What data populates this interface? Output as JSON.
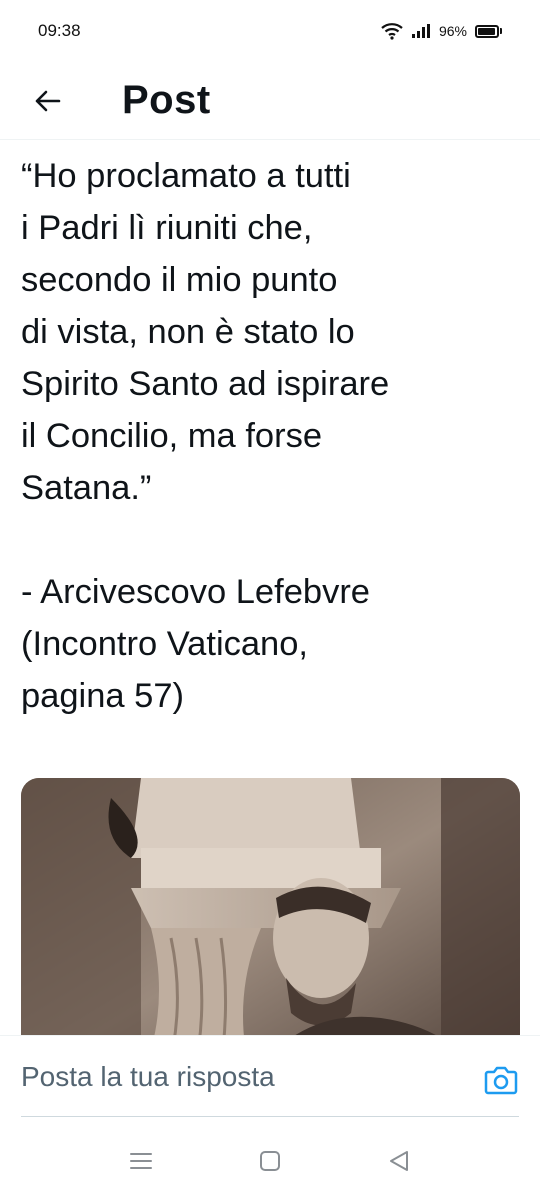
{
  "status_bar": {
    "time": "09:38",
    "battery": "96%",
    "battery_level": 0.96,
    "icons": [
      "wifi-icon",
      "signal-icon",
      "battery-icon"
    ]
  },
  "header": {
    "title": "Post",
    "back_icon": "arrow-left-icon"
  },
  "post": {
    "text": "“Ho proclamato a tutti\ni Padri lì riuniti che,\nsecondo il mio punto\ndi vista, non è stato lo\nSpirito Santo ad ispirare\nil Concilio, ma forse\nSatana.”\n\n- Arcivescovo Lefebvre\n(Incontro Vaticano,\npagina 57)"
  },
  "reply": {
    "placeholder": "Posta la tua risposta",
    "camera_icon": "camera-icon"
  },
  "nav": {
    "icons": [
      "menu-icon",
      "home-icon",
      "back-icon"
    ]
  },
  "colors": {
    "text": "#0f1419",
    "placeholder": "#536471",
    "accent": "#1d9bf0",
    "divider": "#eff3f4",
    "photo_sepia": "#8d7b6d"
  }
}
